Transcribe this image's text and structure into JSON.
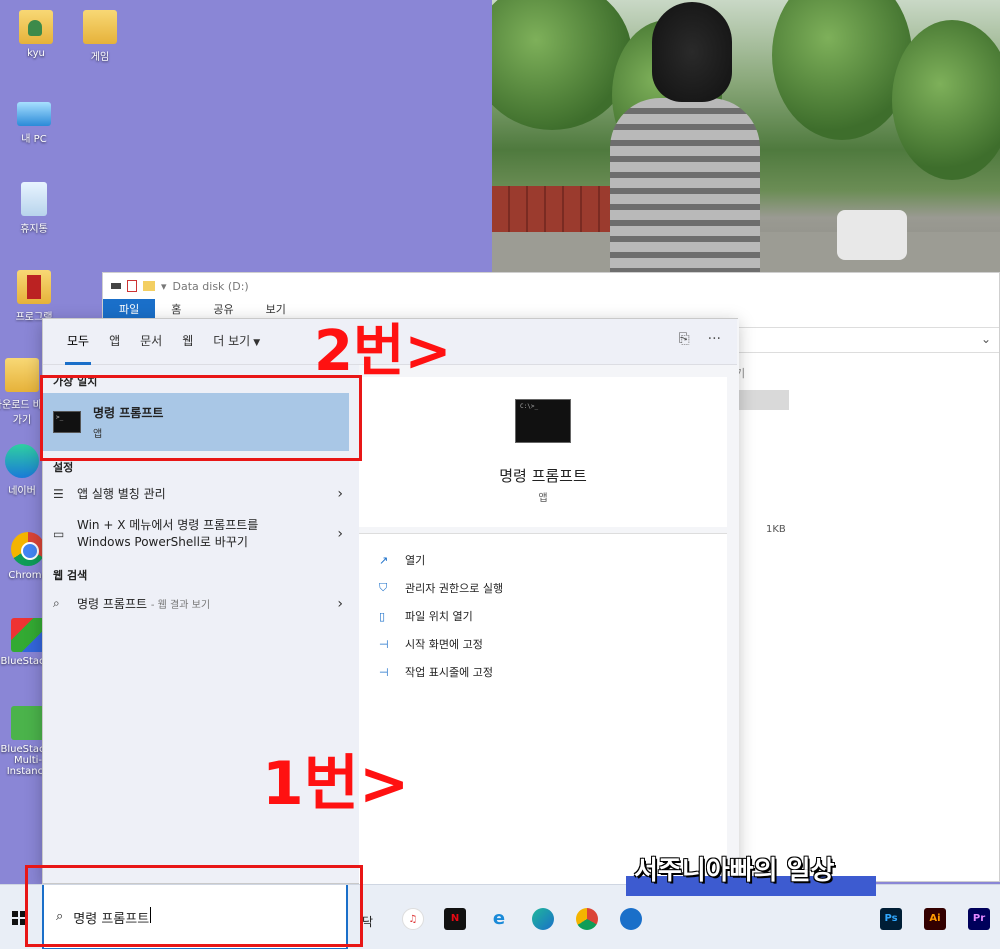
{
  "desktop": {
    "icons": [
      {
        "label": "kyu",
        "icon": "user-folder-icon"
      },
      {
        "label": "게임",
        "icon": "game-folder-icon"
      },
      {
        "label": "내 PC",
        "icon": "computer-icon"
      },
      {
        "label": "휴지통",
        "icon": "recycle-bin-icon"
      },
      {
        "label": "프로그램",
        "icon": "programs-folder-icon"
      },
      {
        "label": "다운로드 바로 가기",
        "icon": "download-shortcut-icon"
      },
      {
        "label": "네이버",
        "icon": "naver-icon"
      },
      {
        "label": "Chrome",
        "icon": "chrome-icon"
      },
      {
        "label": "BlueStacks",
        "icon": "bluestacks-icon"
      },
      {
        "label": "BlueStacks Multi-Instance",
        "icon": "bluestacks-multi-icon"
      }
    ]
  },
  "explorer": {
    "path": "Data disk (D:)",
    "ribbon_tabs": [
      "파일",
      "홈",
      "공유",
      "보기"
    ],
    "column_fragment": "기",
    "file_size": "1KB"
  },
  "start_menu": {
    "tabs": [
      "모두",
      "앱",
      "문서",
      "웹",
      "더 보기"
    ],
    "active_tab": "모두",
    "best_match_header": "가장 일치",
    "best_match": {
      "title": "명령 프롬프트",
      "subtitle": "앱"
    },
    "settings_header": "설정",
    "settings_items": [
      {
        "line1": "앱 실행 별칭 관리",
        "line2": ""
      },
      {
        "line1": "Win + X 메뉴에서 명령 프롬프트를",
        "line2": "Windows PowerShell로 바꾸기"
      }
    ],
    "web_header": "웹 검색",
    "web_item": {
      "label": "명령 프롬프트",
      "sub": "- 웹 결과 보기"
    },
    "detail": {
      "title": "명령 프롬프트",
      "subtitle": "앱",
      "actions": [
        "열기",
        "관리자 권한으로 실행",
        "파일 위치 열기",
        "시작 화면에 고정",
        "작업 표시줄에 고정"
      ]
    }
  },
  "taskbar": {
    "search_value": "명령 프롬프트",
    "stray_text": "닥",
    "apps": [
      "iTunes",
      "Netflix",
      "Internet Explorer",
      "Edge",
      "Chrome",
      "Ps",
      "Ai",
      "Pr"
    ]
  },
  "annotations": {
    "step1": "1번>",
    "step2": "2번>",
    "watermark": "서주니아빠의 일상"
  },
  "colors": {
    "accent": "#1a6fc9",
    "highlight": "#a9c7e6",
    "annotation": "#e81616"
  }
}
